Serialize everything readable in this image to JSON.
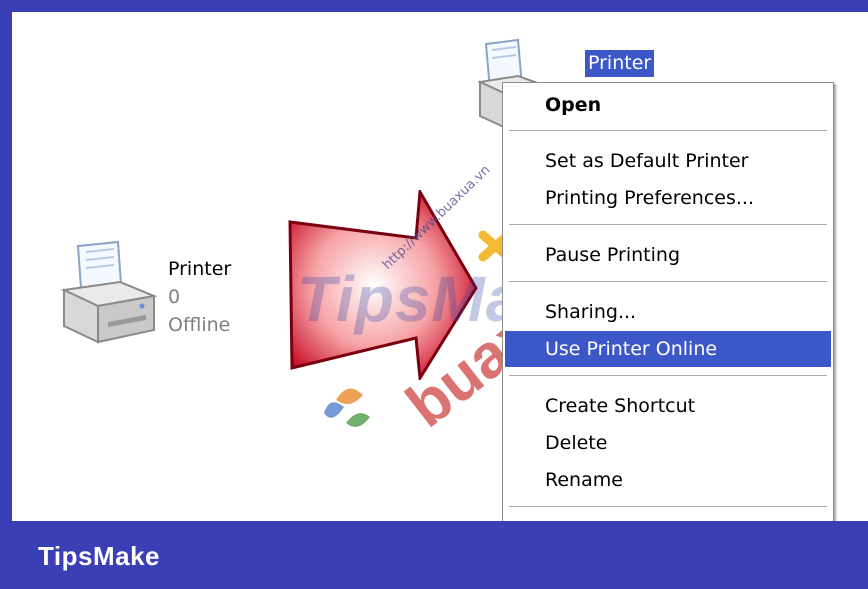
{
  "explorer": {
    "left_item": {
      "name": "Printer",
      "count": "0",
      "status": "Offline",
      "icon": "printer-icon"
    },
    "selected_item": {
      "label": "Printer",
      "icon": "printer-icon"
    }
  },
  "context_menu": {
    "items": [
      {
        "label": "Open",
        "bold": true
      },
      {
        "label": "Set as Default Printer"
      },
      {
        "label": "Printing Preferences..."
      },
      {
        "label": "Pause Printing"
      },
      {
        "label": "Sharing..."
      },
      {
        "label": "Use Printer Online",
        "highlighted": true
      },
      {
        "label": "Create Shortcut"
      },
      {
        "label": "Delete"
      },
      {
        "label": "Rename"
      }
    ]
  },
  "watermark": {
    "brand": "TipsMake",
    "url": "http://www.buaxua.vn"
  },
  "footer": {
    "brand": "TipsMake"
  },
  "colors": {
    "frame": "#3b3fb5",
    "selection": "#3c57c8",
    "arrow": "#e8505a"
  }
}
